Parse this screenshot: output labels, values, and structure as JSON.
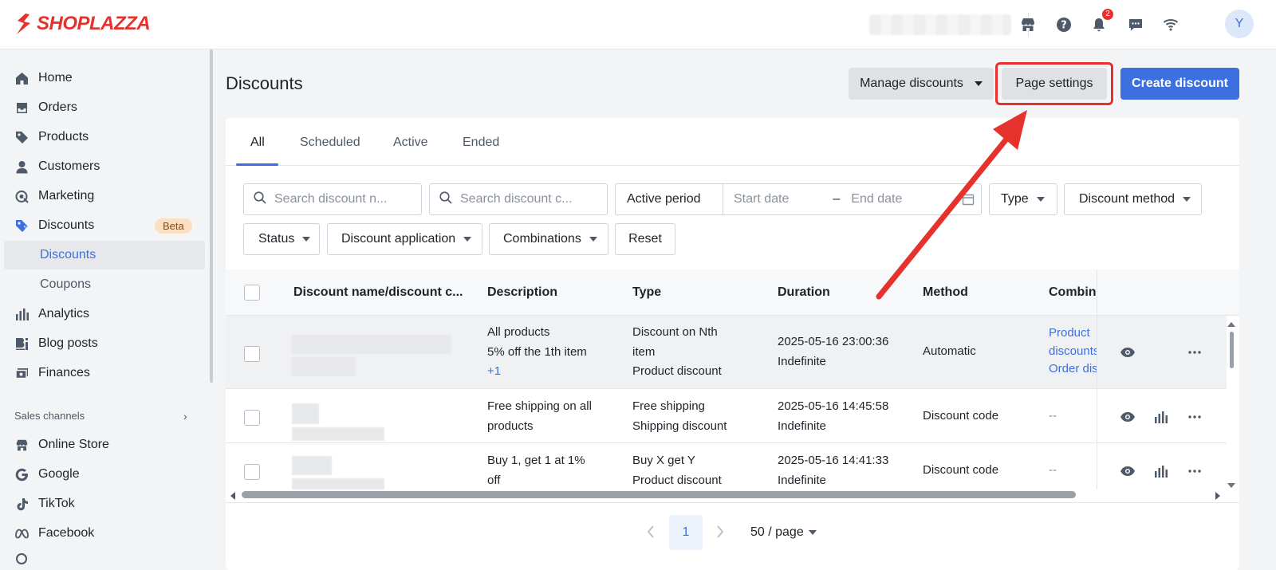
{
  "brand": {
    "name": "SHOPLAZZA",
    "color": "#e5322d",
    "accent": "#3c6fe0"
  },
  "topbar": {
    "notifications_count": "2",
    "avatar_initial": "Y"
  },
  "sidebar": {
    "items": [
      {
        "label": "Home",
        "icon": "home-icon"
      },
      {
        "label": "Orders",
        "icon": "inbox-icon"
      },
      {
        "label": "Products",
        "icon": "tag-icon"
      },
      {
        "label": "Customers",
        "icon": "person-icon"
      },
      {
        "label": "Marketing",
        "icon": "megaphone-icon"
      },
      {
        "label": "Discounts",
        "icon": "discount-tag-icon",
        "badge": "Beta"
      },
      {
        "label": "Analytics",
        "icon": "bar-chart-icon"
      },
      {
        "label": "Blog posts",
        "icon": "blog-icon"
      },
      {
        "label": "Finances",
        "icon": "finance-icon"
      }
    ],
    "sub_items": [
      "Discounts",
      "Coupons"
    ],
    "section_label": "Sales channels",
    "channels": [
      "Online Store",
      "Google",
      "TikTok",
      "Facebook"
    ]
  },
  "page": {
    "title": "Discounts",
    "manage_label": "Manage discounts",
    "page_settings_label": "Page settings",
    "create_label": "Create discount"
  },
  "tabs": [
    "All",
    "Scheduled",
    "Active",
    "Ended"
  ],
  "filters": {
    "search_name_placeholder": "Search discount n...",
    "search_code_placeholder": "Search discount c...",
    "active_period": "Active period",
    "start_date": "Start date",
    "end_date": "End date",
    "type": "Type",
    "method": "Discount method",
    "status": "Status",
    "application": "Discount application",
    "combinations": "Combinations",
    "reset": "Reset"
  },
  "table": {
    "headers": [
      "Discount name/discount c...",
      "Description",
      "Type",
      "Duration",
      "Method",
      "Combina"
    ],
    "rows": [
      {
        "desc": [
          "All products",
          "5% off the 1th item",
          "+1"
        ],
        "type": [
          "Discount on Nth",
          "item",
          "Product discount"
        ],
        "duration": [
          "2025-05-16 23:00:36",
          "Indefinite"
        ],
        "method": "Automatic",
        "combinations": [
          "Product",
          "discounts",
          "Order dis"
        ]
      },
      {
        "desc": [
          "Free shipping on all",
          "products"
        ],
        "type": [
          "Free shipping",
          "Shipping discount"
        ],
        "duration": [
          "2025-05-16 14:45:58",
          "Indefinite"
        ],
        "method": "Discount code",
        "combinations": [
          "--"
        ]
      },
      {
        "desc": [
          "Buy 1, get 1 at 1%",
          "off"
        ],
        "type": [
          "Buy X get Y",
          "Product discount"
        ],
        "duration": [
          "2025-05-16 14:41:33",
          "Indefinite"
        ],
        "method": "Discount code",
        "combinations": [
          "--"
        ]
      }
    ]
  },
  "pagination": {
    "current": "1",
    "per_page": "50 / page"
  }
}
